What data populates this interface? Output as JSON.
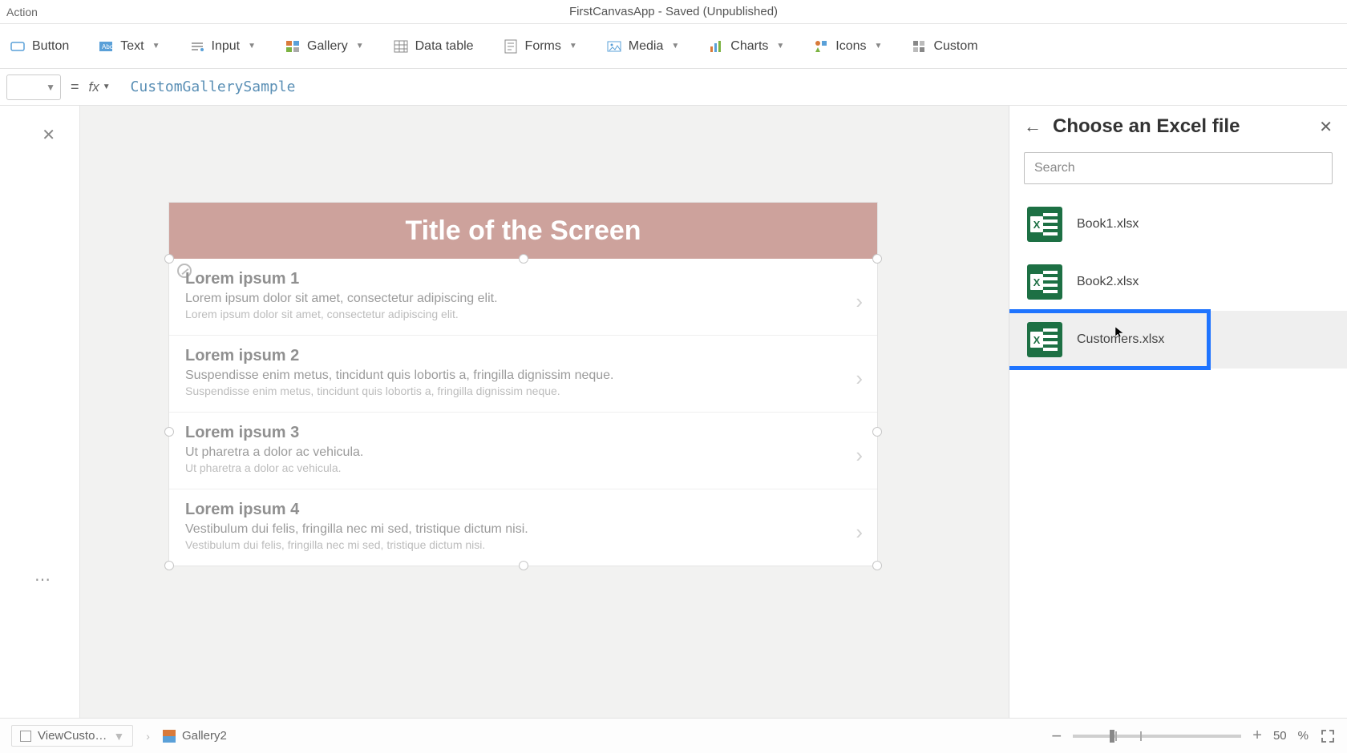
{
  "titlebar": {
    "action": "Action",
    "title": "FirstCanvasApp - Saved (Unpublished)"
  },
  "ribbon": {
    "button": "Button",
    "text": "Text",
    "input": "Input",
    "gallery": "Gallery",
    "datatable": "Data table",
    "forms": "Forms",
    "media": "Media",
    "charts": "Charts",
    "icons": "Icons",
    "custom": "Custom"
  },
  "formula": {
    "value": "CustomGallerySample"
  },
  "canvas": {
    "screen_title": "Title of the Screen",
    "items": [
      {
        "title": "Lorem ipsum 1",
        "body": "Lorem ipsum dolor sit amet, consectetur adipiscing elit.",
        "sub": "Lorem ipsum dolor sit amet, consectetur adipiscing elit."
      },
      {
        "title": "Lorem ipsum 2",
        "body": "Suspendisse enim metus, tincidunt quis lobortis a, fringilla dignissim neque.",
        "sub": "Suspendisse enim metus, tincidunt quis lobortis a, fringilla dignissim neque."
      },
      {
        "title": "Lorem ipsum 3",
        "body": "Ut pharetra a dolor ac vehicula.",
        "sub": "Ut pharetra a dolor ac vehicula."
      },
      {
        "title": "Lorem ipsum 4",
        "body": "Vestibulum dui felis, fringilla nec mi sed, tristique dictum nisi.",
        "sub": "Vestibulum dui felis, fringilla nec mi sed, tristique dictum nisi."
      }
    ]
  },
  "rightpane": {
    "title": "Choose an Excel file",
    "search_placeholder": "Search",
    "files": [
      {
        "name": "Book1.xlsx",
        "selected": false
      },
      {
        "name": "Book2.xlsx",
        "selected": false
      },
      {
        "name": "Customers.xlsx",
        "selected": true
      }
    ]
  },
  "status": {
    "screen": "ViewCusto…",
    "gallery": "Gallery2",
    "zoom": "50",
    "zoom_unit": "%"
  }
}
